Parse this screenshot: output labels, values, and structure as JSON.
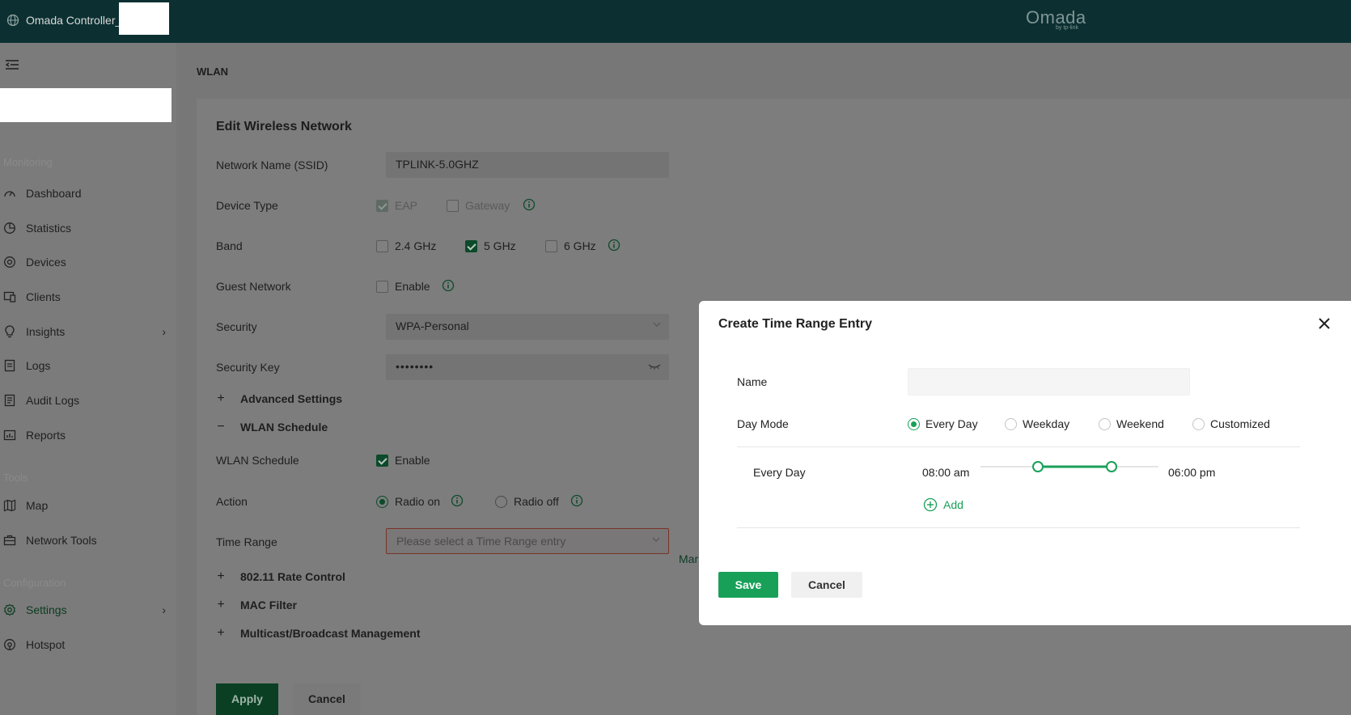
{
  "topbar": {
    "title": "Omada Controller_",
    "logo": "Omada",
    "logo_sub": "by tp-link",
    "globe_icon": "globe-icon"
  },
  "sidebar": {
    "collapse_icon": "menu-collapse-icon",
    "sections": {
      "monitoring": "Monitoring",
      "tools": "Tools",
      "configuration": "Configuration"
    },
    "items": [
      {
        "label": "Dashboard",
        "icon": "dashboard-icon"
      },
      {
        "label": "Statistics",
        "icon": "pie-chart-icon"
      },
      {
        "label": "Devices",
        "icon": "devices-icon"
      },
      {
        "label": "Clients",
        "icon": "clients-icon"
      },
      {
        "label": "Insights",
        "icon": "bulb-icon",
        "has_chevron": true
      },
      {
        "label": "Logs",
        "icon": "logs-icon"
      },
      {
        "label": "Audit Logs",
        "icon": "audit-logs-icon"
      },
      {
        "label": "Reports",
        "icon": "reports-icon"
      },
      {
        "label": "Map",
        "icon": "map-icon"
      },
      {
        "label": "Network Tools",
        "icon": "toolbox-icon"
      },
      {
        "label": "Settings",
        "icon": "gear-icon",
        "has_chevron": true,
        "active": true
      },
      {
        "label": "Hotspot",
        "icon": "hotspot-icon"
      }
    ],
    "chevron": "›"
  },
  "breadcrumb": "WLAN",
  "form": {
    "title": "Edit Wireless Network",
    "ssid_label": "Network Name (SSID)",
    "ssid_value": "TPLINK-5.0GHZ",
    "device_type_label": "Device Type",
    "device_type_options": [
      "EAP",
      "Gateway"
    ],
    "band_label": "Band",
    "band_options": [
      "2.4 GHz",
      "5 GHz",
      "6 GHz"
    ],
    "guest_label": "Guest Network",
    "guest_option": "Enable",
    "security_label": "Security",
    "security_value": "WPA-Personal",
    "key_label": "Security Key",
    "key_value": "••••••••",
    "advanced_label": "Advanced Settings",
    "wlan_schedule_section": "WLAN Schedule",
    "wlan_schedule_label": "WLAN Schedule",
    "wlan_schedule_option": "Enable",
    "action_label": "Action",
    "action_options": [
      "Radio on",
      "Radio off"
    ],
    "time_range_label": "Time Range",
    "time_range_placeholder": "Please select a Time Range entry",
    "manage_link": "Mar",
    "rate_control_label": "802.11 Rate Control",
    "mac_filter_label": "MAC Filter",
    "multicast_label": "Multicast/Broadcast Management",
    "apply": "Apply",
    "cancel": "Cancel",
    "plus": "+",
    "minus": "−"
  },
  "modal": {
    "title": "Create Time Range Entry",
    "name_label": "Name",
    "name_value": "",
    "day_mode_label": "Day Mode",
    "day_modes": [
      "Every Day",
      "Weekday",
      "Weekend",
      "Customized"
    ],
    "selected_day_mode": "Every Day",
    "row_label": "Every Day",
    "start_time": "08:00 am",
    "end_time": "06:00 pm",
    "add_label": "Add",
    "save": "Save",
    "cancel": "Cancel"
  },
  "colors": {
    "accent": "#18a058",
    "topbar": "#0c3031"
  }
}
